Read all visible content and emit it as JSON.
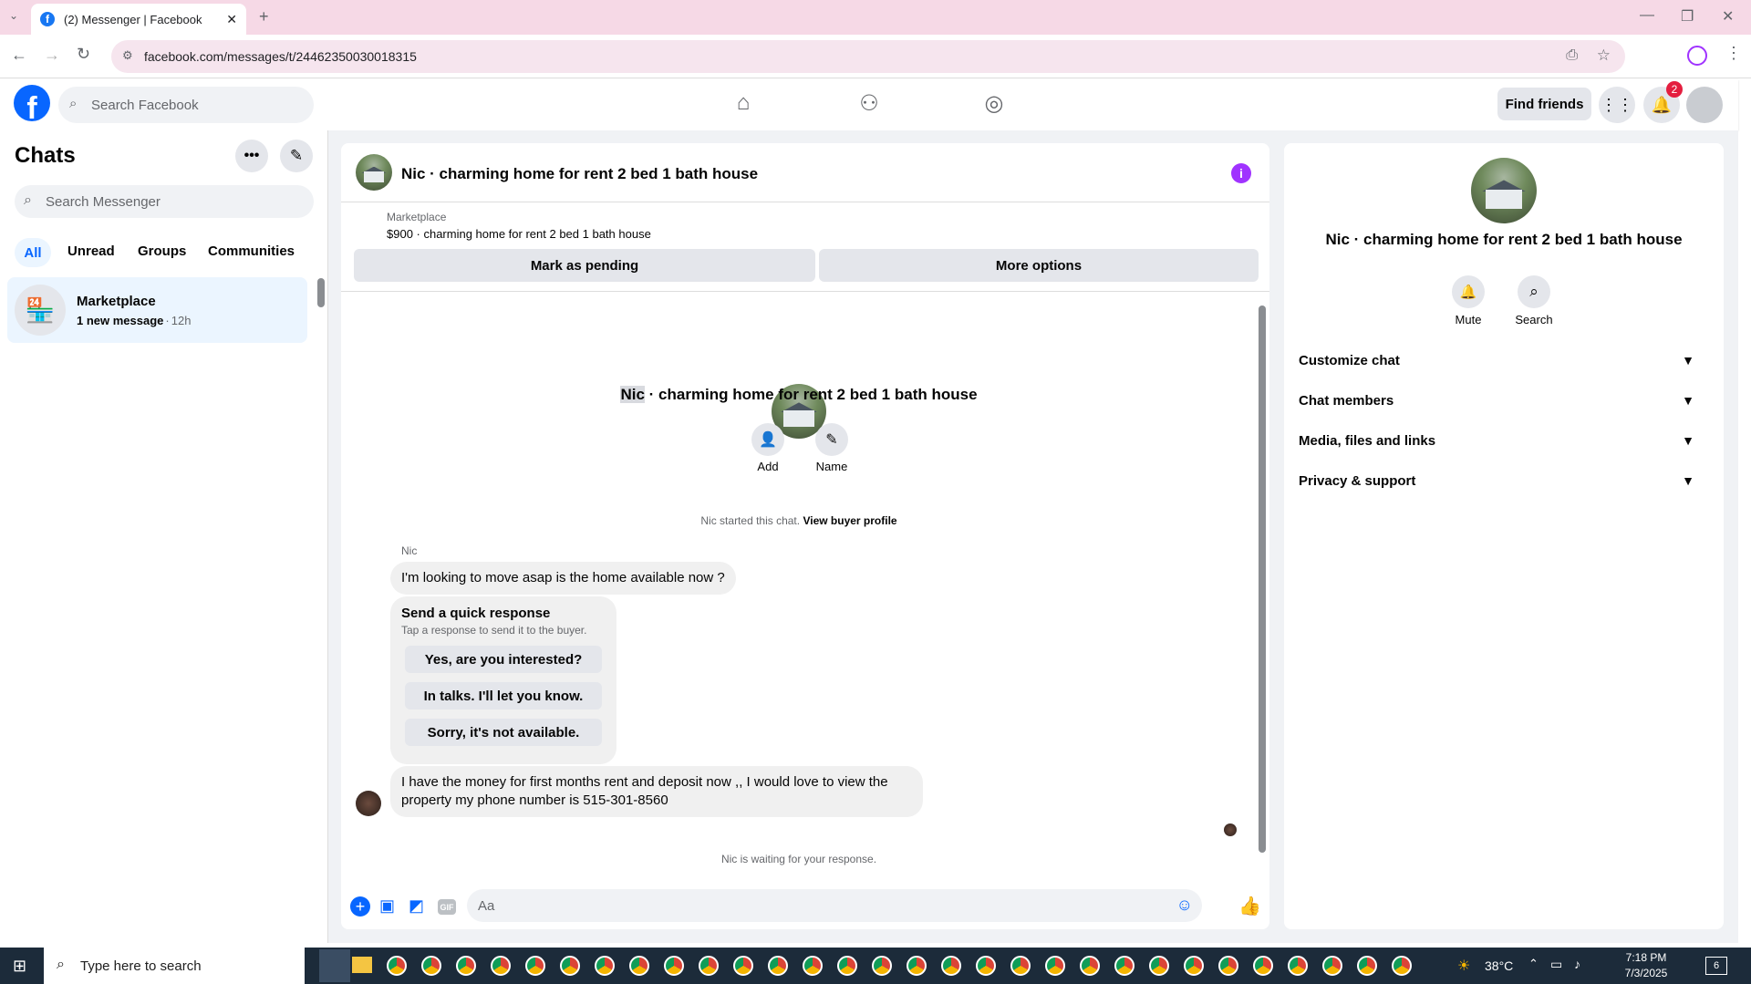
{
  "browser": {
    "tab_title": "(2) Messenger | Facebook",
    "url": "facebook.com/messages/t/24462350030018315"
  },
  "fb_header": {
    "search_placeholder": "Search Facebook",
    "find_friends": "Find friends",
    "notification_count": "2"
  },
  "sidebar": {
    "title": "Chats",
    "search_placeholder": "Search Messenger",
    "filters": [
      "All",
      "Unread",
      "Groups",
      "Communities"
    ],
    "active_filter": "All",
    "chats": [
      {
        "name": "Marketplace",
        "preview": "1 new message",
        "time": "12h"
      }
    ]
  },
  "conversation": {
    "title": "Nic · charming home for rent 2 bed 1 bath house",
    "listing": {
      "source": "Marketplace",
      "summary": "$900 · charming home for rent 2 bed 1 bath house",
      "mark_pending": "Mark as pending",
      "more_options": "More options"
    },
    "intro": {
      "name_highlight": "Nic",
      "name_rest": " · charming home for rent 2 bed 1 bath house",
      "add_label": "Add",
      "name_label": "Name",
      "started_text": "Nic started this chat.",
      "view_profile": "View buyer profile"
    },
    "sender": "Nic",
    "message1": "I'm looking to move asap is the home available now ?",
    "quick_response": {
      "title": "Send a quick response",
      "subtitle": "Tap a response to send it to the buyer.",
      "options": [
        "Yes, are you interested?",
        "In talks. I'll let you know.",
        "Sorry, it's not available."
      ]
    },
    "message2": "I have the money for first months rent and deposit now ,, I would love to view the property my phone number is 515-301-8560",
    "waiting": "Nic is waiting for your response.",
    "composer_placeholder": "Aa"
  },
  "details": {
    "title": "Nic · charming home for rent 2 bed 1 bath house",
    "mute": "Mute",
    "search": "Search",
    "sections": [
      "Customize chat",
      "Chat members",
      "Media, files and links",
      "Privacy & support"
    ]
  },
  "taskbar": {
    "search_placeholder": "Type here to search",
    "weather": "38°C",
    "time": "7:18 PM",
    "date": "7/3/2025",
    "notif_count": "6"
  },
  "colors": {
    "fb_blue": "#0866ff",
    "messenger_purple": "#a033ff",
    "active_chat_bg": "#ebf5ff"
  }
}
